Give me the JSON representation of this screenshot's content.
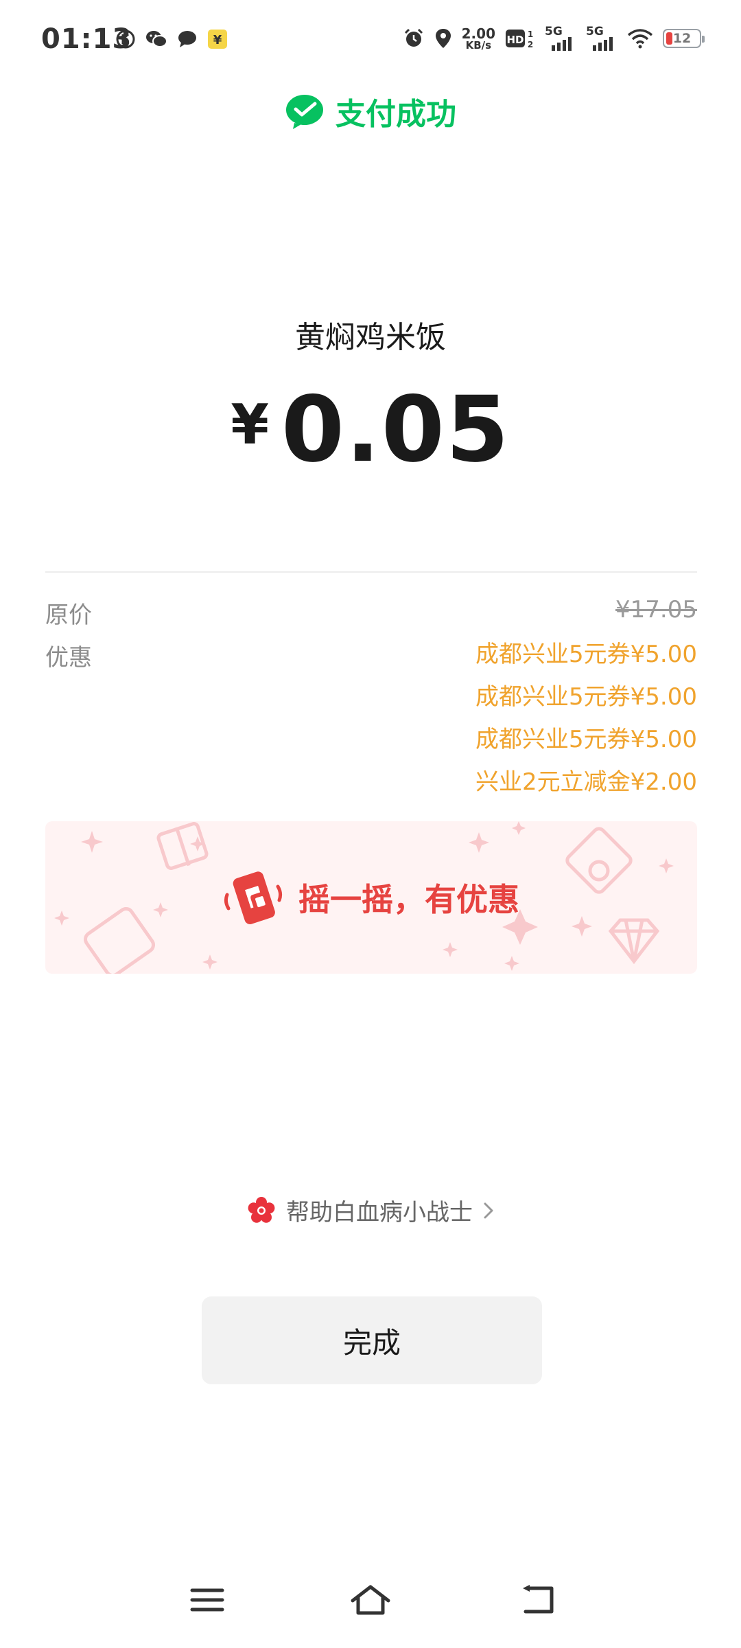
{
  "status_bar": {
    "time": "01:13",
    "net_speed_value": "2.00",
    "net_speed_unit": "KB/s",
    "signal_1": "5G",
    "signal_2": "5G",
    "battery": "12",
    "left_icons": [
      "k-icon",
      "wechat-icon",
      "message-icon",
      "yuan-pay-icon"
    ],
    "right_icons": [
      "alarm-icon",
      "location-icon",
      "hd-icon",
      "signal-icon",
      "signal-icon",
      "wifi-icon",
      "battery-icon"
    ]
  },
  "header": {
    "title": "支付成功",
    "icon": "wechat-pay-check-icon",
    "color": "#07c160"
  },
  "payment": {
    "merchant": "黄焖鸡米饭",
    "currency_symbol": "¥",
    "amount": "0.05"
  },
  "breakdown": {
    "original_label": "原价",
    "original_price": "¥17.05",
    "discount_label": "优惠",
    "discounts": [
      "成都兴业5元券¥5.00",
      "成都兴业5元券¥5.00",
      "成都兴业5元券¥5.00",
      "兴业2元立减金¥2.00"
    ],
    "discount_color": "#f0a32d"
  },
  "shake_banner": {
    "label": "摇一摇，有优惠",
    "icon": "shake-phone-icon",
    "color": "#e64340"
  },
  "charity": {
    "text": "帮助白血病小战士",
    "icon": "red-flower-icon"
  },
  "done_button": {
    "label": "完成"
  },
  "nav_bar": {
    "items": [
      "menu-icon",
      "home-icon",
      "back-icon"
    ]
  }
}
